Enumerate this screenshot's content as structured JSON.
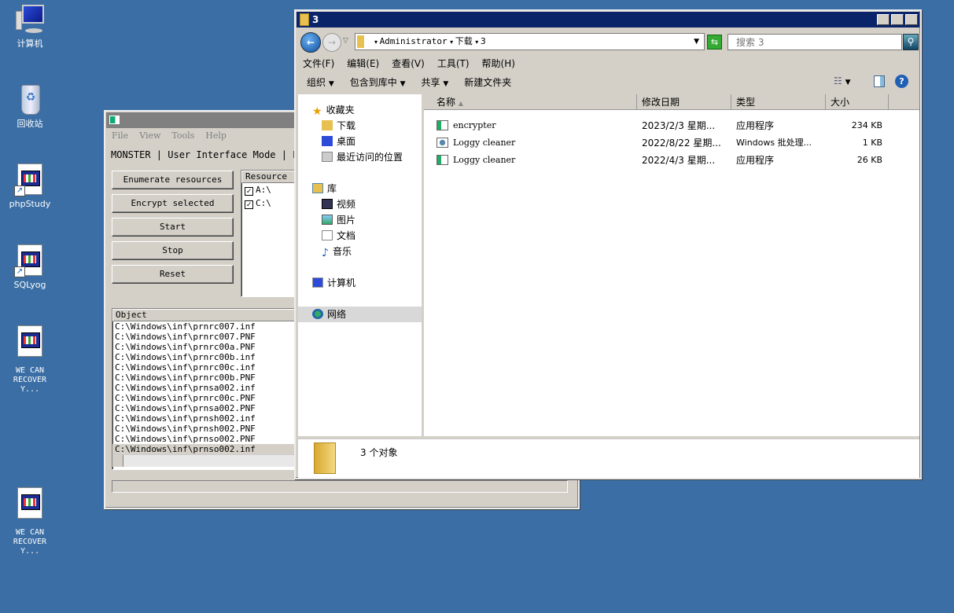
{
  "desktop": {
    "icons": [
      {
        "label": "计算机",
        "icon": "computer-icon"
      },
      {
        "label": "回收站",
        "icon": "recycle-bin-icon"
      },
      {
        "label": "phpStudy",
        "icon": "shortcut-app-icon"
      },
      {
        "label": "SQLyog",
        "icon": "shortcut-app-icon"
      },
      {
        "label": "WE CAN RECOVER Y...",
        "icon": "app-icon"
      },
      {
        "label": "WE CAN RECOVER Y...",
        "icon": "app-icon"
      }
    ],
    "background": "#3a6ea5"
  },
  "monster": {
    "menu": [
      "File",
      "View",
      "Tools",
      "Help"
    ],
    "status_line": "MONSTER | User Interface Mode | P",
    "buttons": [
      "Enumerate resources",
      "Encrypt selected",
      "Start",
      "Stop",
      "Reset"
    ],
    "resource_header": "Resource",
    "resources": [
      {
        "label": "A:\\",
        "checked": true
      },
      {
        "label": "C:\\",
        "checked": true
      }
    ],
    "object_header": "Object",
    "objects": [
      "C:\\Windows\\inf\\prnrc007.inf",
      "C:\\Windows\\inf\\prnrc007.PNF",
      "C:\\Windows\\inf\\prnrc00a.PNF",
      "C:\\Windows\\inf\\prnrc00b.inf",
      "C:\\Windows\\inf\\prnrc00c.inf",
      "C:\\Windows\\inf\\prnrc00b.PNF",
      "C:\\Windows\\inf\\prnsa002.inf",
      "C:\\Windows\\inf\\prnrc00c.PNF",
      "C:\\Windows\\inf\\prnsa002.PNF",
      "C:\\Windows\\inf\\prnsh002.inf",
      "C:\\Windows\\inf\\prnsh002.PNF",
      "C:\\Windows\\inf\\prnso002.PNF",
      "C:\\Windows\\inf\\prnso002.inf"
    ]
  },
  "explorer": {
    "title": "3",
    "breadcrumb": [
      "Administrator",
      "下载",
      "3"
    ],
    "search_placeholder": "搜索 3",
    "menu": [
      "文件(F)",
      "编辑(E)",
      "查看(V)",
      "工具(T)",
      "帮助(H)"
    ],
    "toolbar": [
      "组织",
      "包含到库中",
      "共享",
      "新建文件夹"
    ],
    "nav": {
      "favorites": "收藏夹",
      "fav_items": [
        "下载",
        "桌面",
        "最近访问的位置"
      ],
      "libraries": "库",
      "lib_items": [
        "视频",
        "图片",
        "文档",
        "音乐"
      ],
      "computer": "计算机",
      "network": "网络"
    },
    "columns": [
      "名称",
      "修改日期",
      "类型",
      "大小"
    ],
    "files": [
      {
        "name": "encrypter",
        "date": "2023/2/3 星期...",
        "type": "应用程序",
        "size": "234 KB",
        "icon": "exe-icon"
      },
      {
        "name": "Loggy cleaner",
        "date": "2022/8/22 星期...",
        "type": "Windows 批处理...",
        "size": "1 KB",
        "icon": "batch-file-icon"
      },
      {
        "name": "Loggy cleaner",
        "date": "2022/4/3 星期...",
        "type": "应用程序",
        "size": "26 KB",
        "icon": "exe-icon"
      }
    ],
    "status": "3 个对象",
    "title_color": "#0a246a"
  }
}
